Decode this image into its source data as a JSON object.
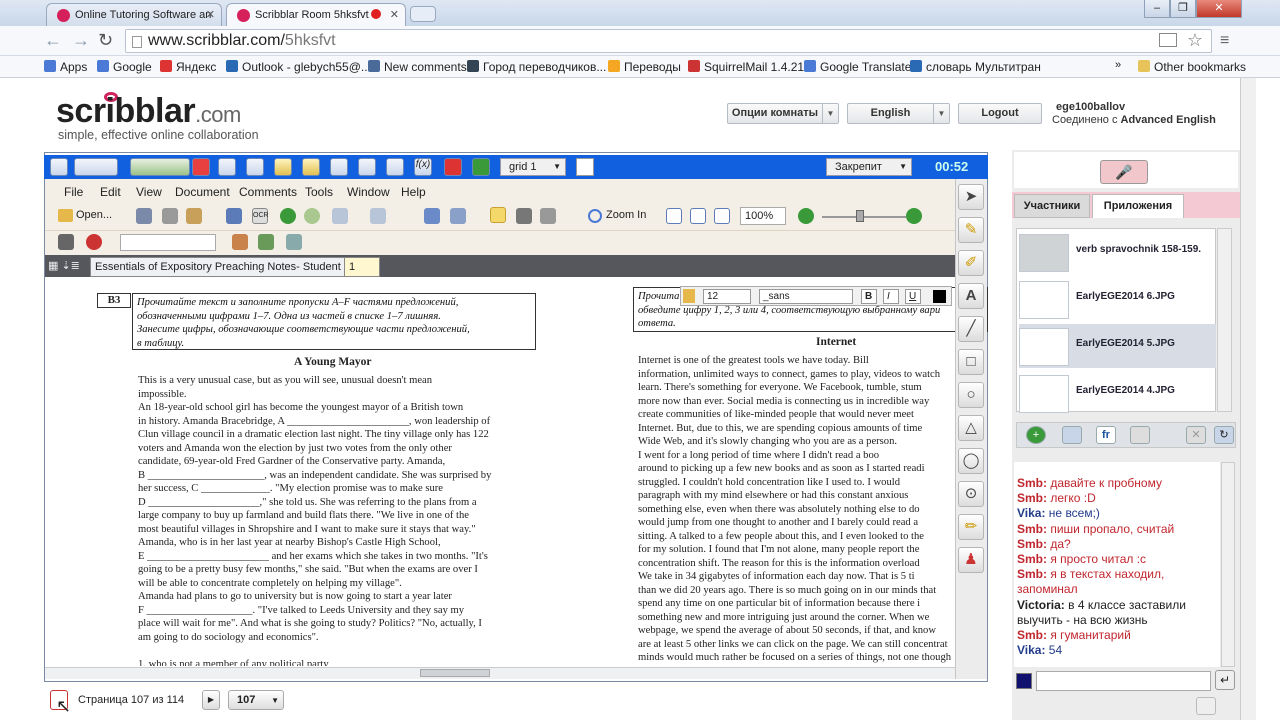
{
  "browser": {
    "tabs": [
      {
        "title": "Online Tutoring Software an"
      },
      {
        "title": "Scribblar Room 5hksfvt -"
      }
    ],
    "url_host": "www.scribblar.com/",
    "url_path": "5hksfvt",
    "bookmarks": [
      {
        "label": "Apps",
        "color": "#4a79d6"
      },
      {
        "label": "Google",
        "color": "#4a79d6"
      },
      {
        "label": "Яндекс",
        "color": "#d33"
      },
      {
        "label": "Outlook - glebych55@...",
        "color": "#2a6ab5"
      },
      {
        "label": "New comments",
        "color": "#4a6a9a"
      },
      {
        "label": "Город переводчиков...",
        "color": "#345"
      },
      {
        "label": "Переводы",
        "color": "#f5a623"
      },
      {
        "label": "SquirrelMail 1.4.21",
        "color": "#c33"
      },
      {
        "label": "Google Translate",
        "color": "#4a79d6"
      },
      {
        "label": "словарь Мультитран",
        "color": "#2a6ab5"
      }
    ],
    "more": "»",
    "other_bookmarks": "Other bookmarks"
  },
  "header": {
    "logo": "scribblar",
    "logo_suffix": ".com",
    "tagline": "simple, effective online collaboration",
    "room_options": "Опции комнаты",
    "language": "English",
    "logout": "Logout",
    "user": "ege100ballov",
    "connected_prefix": "Соединено с",
    "connected_to": "Advanced English"
  },
  "viewer": {
    "grid": "grid 1",
    "pin": "Закрепит",
    "timer": "00:52",
    "menu": [
      "File",
      "Edit",
      "View",
      "Document",
      "Comments",
      "Tools",
      "Window",
      "Help"
    ],
    "open": "Open...",
    "zoom_in": "Zoom In",
    "zoom": "100%",
    "doc_tab": "Essentials of Expository Preaching Notes- Student",
    "doc_tab2": "1",
    "font_size": "12",
    "font_name": "_sans",
    "bold": "B",
    "italic": "I",
    "underline": "U"
  },
  "doc": {
    "label": "B3",
    "instruction": [
      "Прочитайте текст и заполните пропуски A–F частями предложений,",
      "обозначенными цифрами 1–7. Одна из частей в списке 1–7 лишняя.",
      "Занесите цифры, обозначающие соответствующие части предложений,",
      "в таблицу."
    ],
    "title": "A Young Mayor",
    "lines": [
      "      This is a very unusual case, but as you will see, unusual doesn't mean",
      "impossible.",
      "      An 18-year-old school girl has become the youngest mayor of a British town",
      "in history. Amanda Bracebridge, A _______________________, won leadership of",
      "Clun village council in a dramatic election last night. The tiny village only has 122",
      "voters and Amanda won the election by just two votes from the only other",
      "candidate, 69-year-old Fred Gardner of the Conservative party. Amanda,",
      "B ______________________, was an independent candidate. She was surprised by",
      "her success, C _____________. \"My election promise was to make sure",
      "D _____________________,\" she told us. She was referring to the plans from a",
      "large company to buy up farmland and build flats there. \"We live in one of the",
      "most beautiful villages in Shropshire and I want to make sure it stays that way.\"",
      "      Amanda, who is in her last year at nearby Bishop's Castle High School,",
      "E _______________________ and her exams which she takes in two months. \"It's",
      "going to be a pretty busy few months,\" she said. \"But when the exams are over I",
      "will be able to concentrate completely on helping my village\".",
      "      Amanda had plans to go to university but is now going to start a year later",
      "F ____________________. \"I've talked to Leeds University and they say my",
      "place will wait for me\". And what is she going to study? Politics? \"No, actually, I",
      "am going to do sociology and economics\".",
      "",
      "1.   who is not a member of any political party"
    ],
    "r_instruction": [
      "Прочита",
      "обведите цифру 1, 2, 3 или 4, соответствующую выбранному вари",
      "ответа."
    ],
    "r_title": "Internet",
    "r_lines": [
      "      Internet is one of the greatest tools we have today. Bill",
      "information, unlimited ways to connect, games to play, videos to watch",
      "learn. There's something for everyone. We Facebook, tumble, stum",
      "more now than ever. Social media is connecting us in incredible way",
      "create communities of like-minded people that would never meet",
      "Internet. But, due to this, we are spending copious amounts of time",
      "Wide Web, and it's slowly changing who you are as a person.",
      "      I went for a long period of time where I didn't read a boo",
      "around to picking up a few new books and as soon as I started readi",
      "struggled. I couldn't hold concentration like I used to. I would",
      "paragraph with my mind elsewhere or had this constant anxious",
      "something else, even when there was absolutely nothing else to do",
      "would jump from one thought to another and I barely could read a",
      "sitting. A talked to a few people about this, and I even looked to the",
      "for my solution. I found that I'm not alone, many people report the",
      "concentration shift. The reason for this is the information overload",
      "      We take in 34 gigabytes of information each day now. That is 5 ti",
      "than we did 20 years ago. There is so much going on in our minds that",
      "spend any time on one particular bit of information because there i",
      "something new and more intriguing just around the corner. When we",
      "webpage, we spend the average of about 50 seconds, if that, and know",
      "are at least 5 other links we can click on the page. We can still concentrat",
      "minds would much rather be focused on a series of things, not one though"
    ]
  },
  "pagenav": {
    "label": "Страница 107 из 114",
    "page": "107"
  },
  "panel": {
    "tab_participants": "Участники",
    "tab_apps": "Приложения",
    "apps": [
      {
        "name": "verb spravochnik 158-159."
      },
      {
        "name": "EarlyEGE2014 6.JPG"
      },
      {
        "name": "EarlyEGE2014 5.JPG"
      },
      {
        "name": "EarlyEGE2014 4.JPG"
      }
    ],
    "chat": [
      {
        "who": "Smb:",
        "text": " давайте к пробному",
        "c": "#c0262e",
        "tc": "#c0262e"
      },
      {
        "who": "Smb:",
        "text": " легко :D",
        "c": "#c0262e",
        "tc": "#c0262e"
      },
      {
        "who": "Vika:",
        "text": " не всем;)",
        "c": "#233c8a",
        "tc": "#233c8a"
      },
      {
        "who": "Smb:",
        "text": " пиши пропало, считай",
        "c": "#c0262e",
        "tc": "#c0262e"
      },
      {
        "who": "Smb:",
        "text": " да?",
        "c": "#c0262e",
        "tc": "#c0262e"
      },
      {
        "who": "Smb:",
        "text": " я просто читал :с",
        "c": "#c0262e",
        "tc": "#c0262e"
      },
      {
        "who": "Smb:",
        "text": " я в текстах находил,",
        "c": "#c0262e",
        "tc": "#c0262e"
      },
      {
        "who": "",
        "text": "запоминал",
        "c": "#c0262e",
        "tc": "#c0262e"
      },
      {
        "who": "Victoria:",
        "text": " в 4 классе заставили",
        "c": "#222",
        "tc": "#222"
      },
      {
        "who": "",
        "text": "выучить - на всю жизнь",
        "c": "#222",
        "tc": "#222"
      },
      {
        "who": "Smb:",
        "text": " я гуманитарий",
        "c": "#c0262e",
        "tc": "#c0262e"
      },
      {
        "who": "Vika:",
        "text": " 54",
        "c": "#233c8a",
        "tc": "#233c8a"
      }
    ]
  }
}
